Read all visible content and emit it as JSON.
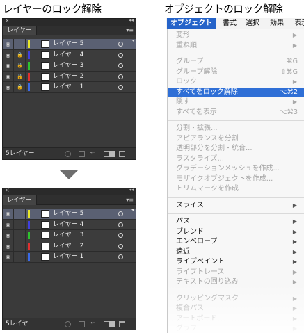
{
  "headings": {
    "left": "レイヤーのロック解除",
    "right": "オブジェクトのロック解除"
  },
  "panel_before": {
    "tab": "レイヤー",
    "count": "5レイヤー",
    "layers": [
      {
        "name": "レイヤー 5",
        "color": "#e6e62a",
        "locked": false,
        "selected": true
      },
      {
        "name": "レイヤー 4",
        "color": "#4040e0",
        "locked": true,
        "selected": false
      },
      {
        "name": "レイヤー 3",
        "color": "#2ec22e",
        "locked": true,
        "selected": false
      },
      {
        "name": "レイヤー 2",
        "color": "#e03030",
        "locked": true,
        "selected": false
      },
      {
        "name": "レイヤー 1",
        "color": "#3a6ae6",
        "locked": true,
        "selected": false
      }
    ]
  },
  "panel_after": {
    "tab": "レイヤー",
    "count": "5レイヤー",
    "layers": [
      {
        "name": "レイヤー 5",
        "color": "#e6e62a",
        "locked": false,
        "selected": true
      },
      {
        "name": "レイヤー 4",
        "color": "#4040e0",
        "locked": false,
        "selected": false
      },
      {
        "name": "レイヤー 3",
        "color": "#2ec22e",
        "locked": false,
        "selected": false
      },
      {
        "name": "レイヤー 2",
        "color": "#e03030",
        "locked": false,
        "selected": false
      },
      {
        "name": "レイヤー 1",
        "color": "#3a6ae6",
        "locked": false,
        "selected": false
      }
    ]
  },
  "menubar": [
    "オブジェクト",
    "書式",
    "選択",
    "効果",
    "表示"
  ],
  "menu_items": [
    {
      "label": "変形",
      "state": "disabled",
      "submenu": true
    },
    {
      "label": "重ね順",
      "state": "disabled",
      "submenu": true
    },
    {
      "sep": true
    },
    {
      "label": "グループ",
      "state": "disabled",
      "shortcut": "⌘G"
    },
    {
      "label": "グループ解除",
      "state": "disabled",
      "shortcut": "⇧⌘G"
    },
    {
      "label": "ロック",
      "state": "disabled",
      "submenu": true
    },
    {
      "label": "すべてをロック解除",
      "state": "highlighted",
      "shortcut": "⌥⌘2"
    },
    {
      "label": "隠す",
      "state": "disabled",
      "submenu": true
    },
    {
      "label": "すべてを表示",
      "state": "disabled",
      "shortcut": "⌥⌘3"
    },
    {
      "sep": true
    },
    {
      "label": "分割・拡張...",
      "state": "disabled"
    },
    {
      "label": "アピアランスを分割",
      "state": "disabled"
    },
    {
      "label": "透明部分を分割・統合...",
      "state": "disabled"
    },
    {
      "label": "ラスタライズ...",
      "state": "disabled"
    },
    {
      "label": "グラデーションメッシュを作成...",
      "state": "disabled"
    },
    {
      "label": "モザイクオブジェクトを作成...",
      "state": "disabled"
    },
    {
      "label": "トリムマークを作成",
      "state": "disabled"
    },
    {
      "sep": true
    },
    {
      "label": "スライス",
      "state": "enabled",
      "submenu": true
    },
    {
      "sep": true
    },
    {
      "label": "パス",
      "state": "enabled",
      "submenu": true
    },
    {
      "label": "ブレンド",
      "state": "enabled",
      "submenu": true
    },
    {
      "label": "エンベロープ",
      "state": "enabled",
      "submenu": true
    },
    {
      "label": "遠近",
      "state": "enabled",
      "submenu": true
    },
    {
      "label": "ライブペイント",
      "state": "enabled",
      "submenu": true
    },
    {
      "label": "ライブトレース",
      "state": "disabled",
      "submenu": true
    },
    {
      "label": "テキストの回り込み",
      "state": "disabled",
      "submenu": true
    },
    {
      "sep": true
    },
    {
      "label": "クリッピングマスク",
      "state": "disabled",
      "submenu": true
    },
    {
      "label": "複合パス",
      "state": "disabled",
      "submenu": true
    },
    {
      "label": "アートボード",
      "state": "disabled",
      "submenu": true
    },
    {
      "label": "グラフ",
      "state": "disabled",
      "submenu": true
    }
  ],
  "icons": {
    "eye": "◉",
    "lock": "🔒",
    "submenu_arrow": "▶",
    "close": "×",
    "collapse": "◂◂",
    "panel_menu": "▾≡",
    "clip": "⁴⁼"
  }
}
